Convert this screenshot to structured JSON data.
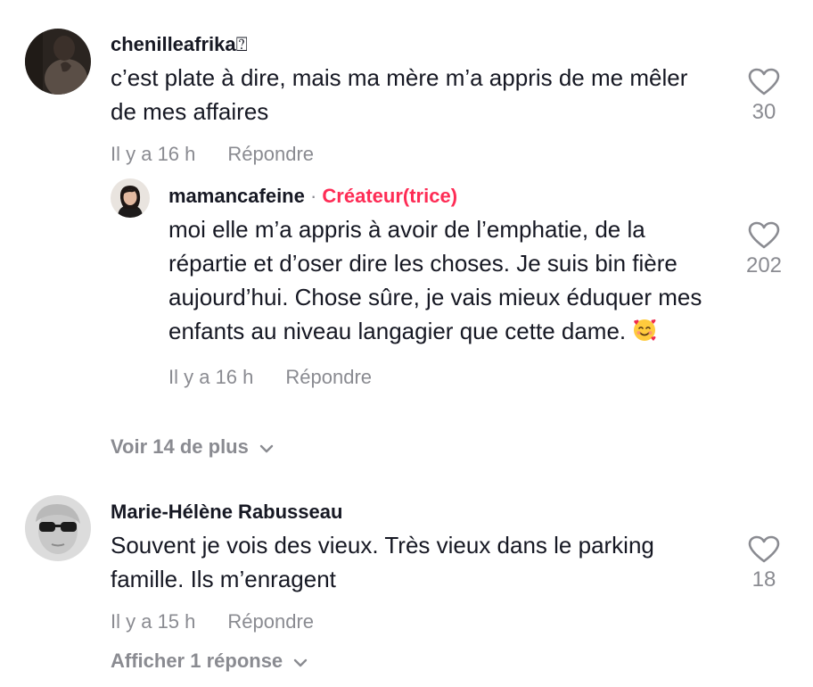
{
  "comments": [
    {
      "username": "chenilleafrika",
      "username_suffix": "⍰",
      "text": "c’est plate à dire, mais ma mère m’a appris de me mêler de mes affaires",
      "time": "Il y a 16 h",
      "reply_label": "Répondre",
      "likes": "30",
      "avatar_icon": "avatar-photo-dark",
      "replies": [
        {
          "username": "mamancafeine",
          "separator": " · ",
          "creator_label": "Créateur(trice)",
          "text": "moi elle m’a appris à avoir de l’emphatie, de la répartie et d’oser dire les choses. Je suis bin fière aujourd’hui. Chose sûre, je vais mieux éduquer mes enfants au niveau langagier que cette dame.",
          "emoji": "smiling-face-with-hearts",
          "time": "Il y a 16 h",
          "reply_label": "Répondre",
          "likes": "202",
          "avatar_icon": "avatar-photo-woman"
        }
      ],
      "more_label": "Voir 14 de plus"
    },
    {
      "username": "Marie-Hélène Rabusseau",
      "text": "Souvent je vois des vieux. Très vieux dans le parking famille. Ils m’enragent",
      "time": "Il y a 15 h",
      "reply_label": "Répondre",
      "likes": "18",
      "avatar_icon": "avatar-photo-sunglasses",
      "more_label": "Afficher 1 réponse"
    }
  ],
  "colors": {
    "text": "#161823",
    "muted": "#8a8b91",
    "creator": "#fe2c55"
  }
}
